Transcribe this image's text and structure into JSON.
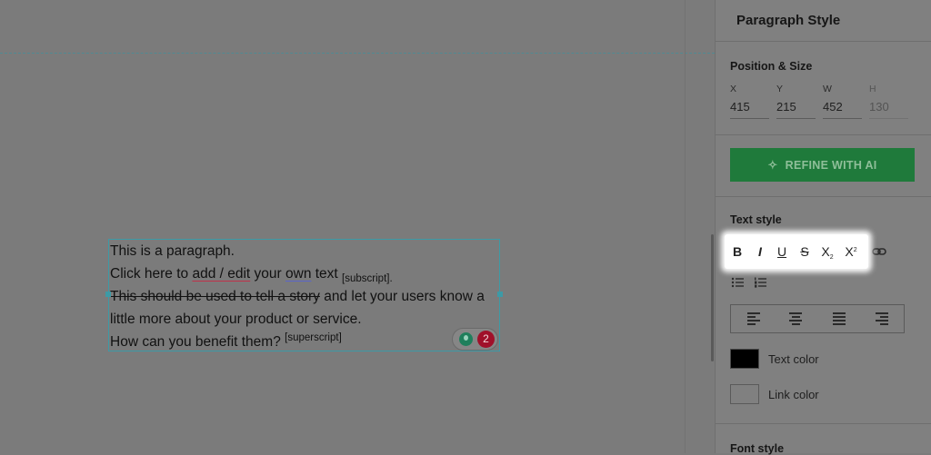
{
  "canvas": {
    "paragraph_lines": [
      {
        "segments": [
          {
            "text": "This is a paragraph.",
            "style": "plain"
          }
        ]
      },
      {
        "segments": [
          {
            "text": "Click here to ",
            "style": "plain"
          },
          {
            "text": "add / edit",
            "style": "spell-red"
          },
          {
            "text": " your ",
            "style": "plain"
          },
          {
            "text": "own",
            "style": "spell-blue"
          },
          {
            "text": " text ",
            "style": "plain"
          },
          {
            "text": "[subscript]",
            "style": "sub"
          },
          {
            "text": ".",
            "style": "plain"
          }
        ]
      },
      {
        "segments": [
          {
            "text": "This should be used to tell a story",
            "style": "strike"
          },
          {
            "text": " and let your users know a",
            "style": "plain"
          }
        ]
      },
      {
        "segments": [
          {
            "text": "little more about your product or service.",
            "style": "plain"
          }
        ]
      },
      {
        "segments": [
          {
            "text": "How can you benefit them? ",
            "style": "plain"
          },
          {
            "text": "[superscript]",
            "style": "sup"
          }
        ]
      }
    ],
    "assistant_badge": {
      "count": "2",
      "icon": "lightbulb-icon"
    }
  },
  "panel": {
    "title": "Paragraph Style",
    "position_size": {
      "title": "Position & Size",
      "fields": [
        {
          "label": "X",
          "value": "415"
        },
        {
          "label": "Y",
          "value": "215"
        },
        {
          "label": "W",
          "value": "452"
        },
        {
          "label": "H",
          "value": "130"
        }
      ]
    },
    "refine_button": {
      "label": "REFINE WITH AI",
      "icon": "sparkle-icon"
    },
    "text_style": {
      "title": "Text style",
      "toolbar": [
        {
          "name": "bold",
          "glyph": "B"
        },
        {
          "name": "italic",
          "glyph": "I"
        },
        {
          "name": "underline",
          "glyph": "U"
        },
        {
          "name": "strikethrough",
          "glyph": "S"
        },
        {
          "name": "subscript",
          "glyph": "X"
        },
        {
          "name": "superscript",
          "glyph": "X"
        }
      ],
      "link_icon": "link-icon",
      "list_icons": [
        "bulleted-list-icon",
        "numbered-list-icon"
      ],
      "alignment": [
        "align-left",
        "align-center",
        "align-justify",
        "align-right"
      ],
      "text_color": {
        "label": "Text color",
        "color": "#000000"
      },
      "link_color": {
        "label": "Link color",
        "color": "#ffffff"
      }
    },
    "font_style": {
      "title": "Font style"
    }
  },
  "colors": {
    "accent_green": "#2bb24c",
    "selection": "#3d9aa6",
    "badge_red": "#c8102e"
  }
}
